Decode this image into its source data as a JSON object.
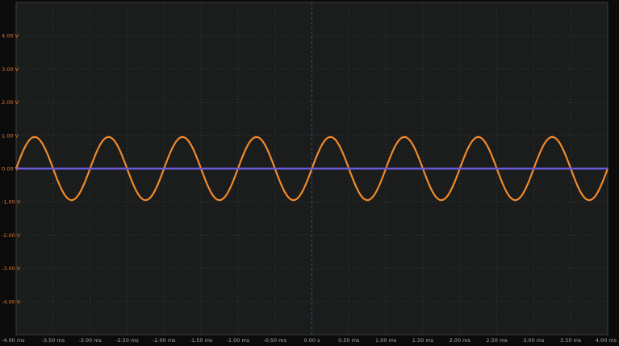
{
  "colors": {
    "background": "#0b0b0b",
    "plot_background": "#1b1c1c",
    "grid": "#3c3e3e",
    "center_marker": "#3c4aa0",
    "y_label": "#e0782f",
    "x_label": "#a8a8a8"
  },
  "chart_data": {
    "type": "line",
    "title": "",
    "xlabel": "",
    "ylabel": "",
    "grid": true,
    "xlim": [
      -4.0,
      4.0
    ],
    "ylim": [
      -5.0,
      5.0
    ],
    "x_ticks": [
      -4.0,
      -3.5,
      -3.0,
      -2.5,
      -2.0,
      -1.5,
      -1.0,
      -0.5,
      0.0,
      0.5,
      1.0,
      1.5,
      2.0,
      2.5,
      3.0,
      3.5,
      4.0
    ],
    "x_tick_labels": [
      "-4.00 ms",
      "-3.50 ms",
      "-3.00 ms",
      "-2.50 ms",
      "-2.00 ms",
      "-1.50 ms",
      "-1.00 ms",
      "-0.50 ms",
      "0.00 s",
      "0.50 ms",
      "1.00 ms",
      "1.50 ms",
      "2.00 ms",
      "2.50 ms",
      "3.00 ms",
      "3.50 ms",
      "4.00 ms"
    ],
    "y_ticks": [
      4.0,
      3.0,
      2.0,
      1.0,
      0.0,
      -1.0,
      -2.0,
      -3.0,
      -4.0
    ],
    "y_tick_labels": [
      "4.00 V",
      "3.00 V",
      "2.00 V",
      "1.00 V",
      "0.00 V",
      "-1.00 V",
      "-2.00 V",
      "-3.00 V",
      "-4.00 V"
    ],
    "series": [
      {
        "color": "#f08a2c",
        "shape": "sine",
        "amplitude": 0.95,
        "offset": 0.0,
        "period": 1.0,
        "phase_zero_crossing_rising": 0.0
      },
      {
        "color": "#6a5bd8",
        "shape": "flat",
        "offset": 0.0
      }
    ]
  }
}
